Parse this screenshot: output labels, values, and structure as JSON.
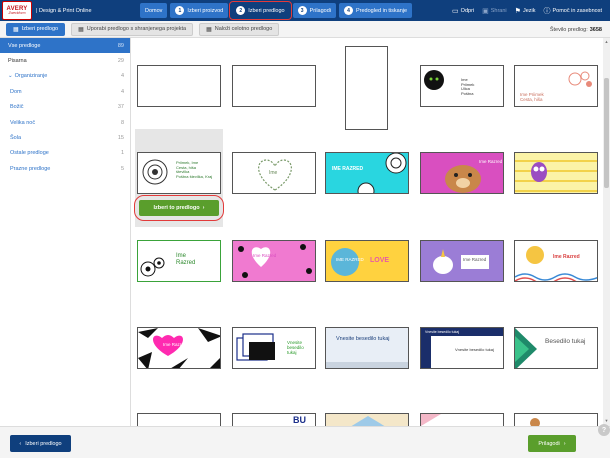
{
  "header": {
    "logo_line1": "AVERY",
    "logo_line2": "Zweckform",
    "app_title": "| Design & Print Online",
    "steps": [
      {
        "num": "",
        "label": "Domov"
      },
      {
        "num": "1",
        "label": "Izberi proizvod"
      },
      {
        "num": "2",
        "label": "Izberi predlogo"
      },
      {
        "num": "3",
        "label": "Prilagodi"
      },
      {
        "num": "4",
        "label": "Predogled in tiskanje"
      }
    ],
    "right": {
      "open": "Odpri",
      "save": "Shrani",
      "language": "Jezik",
      "help": "Pomoč in zasebnost"
    }
  },
  "subbar": {
    "tabs": [
      "Izberi predlogo",
      "Uporabi predlogo s shranjenega projekta",
      "Naloži celotno predlogo"
    ],
    "count_label": "Število predlog:",
    "count_value": "3658"
  },
  "sidebar": {
    "items": [
      {
        "label": "Vse predloge",
        "count": "89"
      },
      {
        "label": "Pisarna",
        "count": "29"
      },
      {
        "label": "Organiziranje",
        "count": "4"
      },
      {
        "label": "Dom",
        "count": "4"
      },
      {
        "label": "Božič",
        "count": "37"
      },
      {
        "label": "Velika noč",
        "count": "8"
      },
      {
        "label": "Šola",
        "count": "15"
      },
      {
        "label": "Ostale predloge",
        "count": "1"
      },
      {
        "label": "Prazne predloge",
        "count": "5"
      }
    ]
  },
  "cards": {
    "r1c4_lines": [
      "Ime",
      "Priimek",
      "Ulica",
      "Poštna"
    ],
    "r1c5_lines": [
      "Ime Priimek",
      "Cesta, hiša"
    ],
    "r2c1_lines": [
      "Priimek, Ime",
      "Cesta, hiša",
      "številka",
      "Poštna številka, Kraj"
    ],
    "r2c2_text": "Ime",
    "r2c3_text": "IME RAZRED",
    "r2c4_text": "Ime Razred",
    "r3c1_lines": [
      "Ime",
      "Razred"
    ],
    "r3c2_text": "Ime Razred",
    "r3c3_text": "IME RAZRED",
    "r3c3_love": "LOVE",
    "r3c4_text": "Ime Razred",
    "r3c5_text": "Ime Razred",
    "r4c1_text": "Ime Razred",
    "r4c2_lines": [
      "Vnesite",
      "besedilo",
      "tukaj"
    ],
    "r4c3_text": "Vnesite besedilo tukaj",
    "r4c4_head": "Vnesite besedilo tukaj",
    "r4c4_text": "Vnesite besedilo tukaj",
    "r4c5_text": "Besedilo tukaj",
    "r5c2_text": "BU"
  },
  "pick_button": "Izberi to predlogo",
  "footer": {
    "back": "Izberi predlogo",
    "next": "Prilagodi"
  },
  "help_badge": "?"
}
